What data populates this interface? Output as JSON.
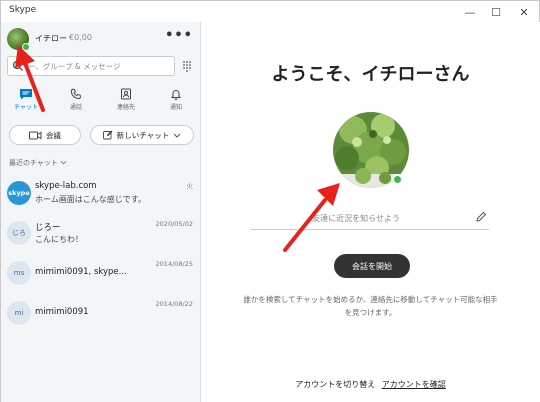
{
  "window": {
    "title": "Skype",
    "minimize": "—",
    "maximize": "☐",
    "close": "✕"
  },
  "profile": {
    "name": "イチロー",
    "credit": "€0,00",
    "more": "•••"
  },
  "search": {
    "placeholder": "ー、グループ & メッセージ"
  },
  "nav": [
    {
      "label": "チャット",
      "icon": "chat-icon",
      "active": true
    },
    {
      "label": "通話",
      "icon": "phone-icon"
    },
    {
      "label": "連絡先",
      "icon": "contacts-icon"
    },
    {
      "label": "通知",
      "icon": "bell-icon"
    }
  ],
  "actions": {
    "meet": "会議",
    "new_chat": "新しいチャット"
  },
  "recent": {
    "label": "最近のチャット"
  },
  "chats": [
    {
      "avatar": "skype",
      "name": "skype-lab.com",
      "message": "ホーム画面はこんな感じです。",
      "date": "火"
    },
    {
      "avatar": "じろ",
      "name": "じろー",
      "message": "こんにちわ！",
      "date": "2020/05/02"
    },
    {
      "avatar": "ms",
      "name": "mimimi0091, skype...",
      "message": "",
      "date": "2014/08/25"
    },
    {
      "avatar": "mi",
      "name": "mimimi0091",
      "message": "",
      "date": "2014/08/22"
    }
  ],
  "main": {
    "welcome": "ようこそ、イチローさん",
    "mood_placeholder": "友達に近況を知らせよう",
    "start_button": "会話を開始",
    "description": "誰かを検索してチャットを始めるか、連絡先に移動してチャット可能な相手を見つけます。",
    "footer_switch": "アカウントを切り替え",
    "footer_confirm": "アカウントを確認"
  },
  "colors": {
    "accent": "#0078d4",
    "online": "#3cb84a",
    "sidebar_bg": "#f3f6f9",
    "arrow": "#e8221b"
  }
}
